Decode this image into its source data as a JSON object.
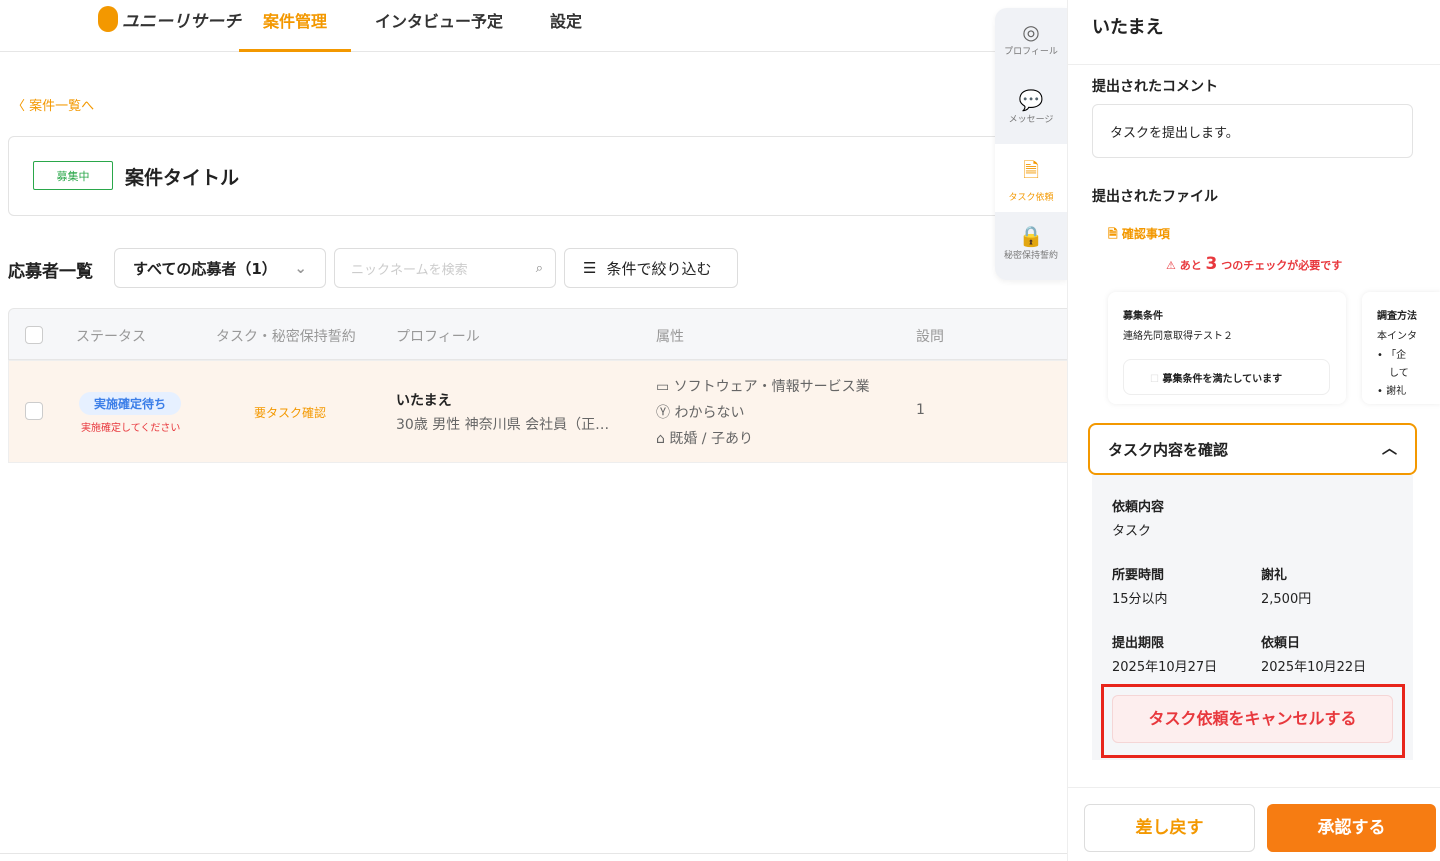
{
  "header": {
    "logo": "ユニーリサーチ",
    "nav": [
      "案件管理",
      "インタビュー予定",
      "設定"
    ]
  },
  "back": "案件一覧へ",
  "project": {
    "status": "募集中",
    "title": "案件タイトル"
  },
  "applicants": {
    "heading": "応募者一覧",
    "filter_select": "すべての応募者（1）",
    "search_placeholder": "ニックネームを検索",
    "filter_button": "条件で絞り込む"
  },
  "table": {
    "columns": [
      "ステータス",
      "タスク・秘密保持誓約",
      "プロフィール",
      "属性",
      "設問"
    ],
    "rows": [
      {
        "status": "実施確定待ち",
        "status_note": "実施確定してください",
        "task": "要タスク確認",
        "name": "いたまえ",
        "profile": "30歳 男性 神奈川県 会社員（正…",
        "attrs": [
          "ソフトウェア・情報サービス業",
          "わからない",
          "既婚 / 子あり"
        ],
        "answers": "1"
      }
    ]
  },
  "sidetabs": [
    "プロフィール",
    "メッセージ",
    "タスク依頼",
    "秘密保持誓約"
  ],
  "panel": {
    "name": "いたまえ",
    "comment_label": "提出されたコメント",
    "comment": "タスクを提出します。",
    "files_label": "提出されたファイル",
    "file": "確認事項",
    "warning_pre": "あと",
    "warning_num": "3",
    "warning_post": "つのチェックが必要です",
    "card1": {
      "title": "募集条件",
      "text": "連絡先同意取得テスト２",
      "check": "募集条件を満たしています"
    },
    "card2": {
      "title": "調査方法",
      "text": "本インタ",
      "bullets": [
        "「企",
        "して",
        "謝礼"
      ]
    },
    "accordion": "タスク内容を確認",
    "request_label": "依頼内容",
    "request": "タスク",
    "time_label": "所要時間",
    "time": "15分以内",
    "reward_label": "謝礼",
    "reward": "2,500円",
    "deadline_label": "提出期限",
    "deadline": "2025年10月27日",
    "date_label": "依頼日",
    "date": "2025年10月22日",
    "cancel": "タスク依頼をキャンセルする",
    "reject": "差し戻す",
    "approve": "承認する"
  },
  "colors": {
    "accent": "#f39800",
    "danger": "#e8383d"
  }
}
